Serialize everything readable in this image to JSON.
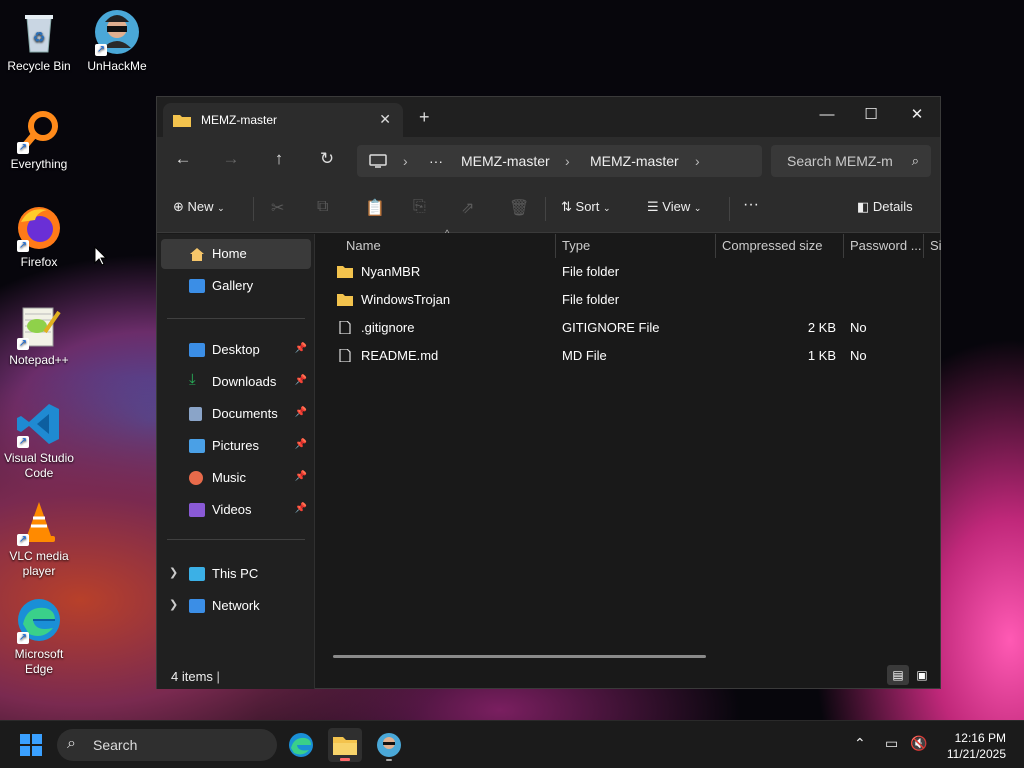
{
  "desktop": {
    "icons": [
      {
        "label": "Recycle Bin",
        "icon": "recycle-bin-icon"
      },
      {
        "label": "UnHackMe",
        "icon": "unhackme-icon"
      },
      {
        "label": "Everything",
        "icon": "everything-icon"
      },
      {
        "label": "Firefox",
        "icon": "firefox-icon"
      },
      {
        "label": "Notepad++",
        "icon": "notepadpp-icon"
      },
      {
        "label": "Visual Studio Code",
        "icon": "vscode-icon"
      },
      {
        "label": "VLC media player",
        "icon": "vlc-icon"
      },
      {
        "label": "Microsoft Edge",
        "icon": "edge-icon"
      }
    ]
  },
  "window": {
    "tab_title": "MEMZ-master",
    "new_tab": "+",
    "controls": {
      "minimize": "—",
      "maximize": "☐",
      "close": "✕"
    }
  },
  "nav": {
    "back": "←",
    "forward": "→",
    "up": "↑",
    "refresh": "↻",
    "breadcrumb": [
      "MEMZ-master",
      "MEMZ-master"
    ],
    "more": "···",
    "search_placeholder": "Search MEMZ-m"
  },
  "toolbar": {
    "new_label": "New",
    "sort_label": "Sort",
    "view_label": "View",
    "more": "···",
    "details_label": "Details"
  },
  "sidebar": {
    "top": [
      {
        "label": "Home",
        "icon": "home-icon",
        "color": "#f6c66a",
        "selected": true
      },
      {
        "label": "Gallery",
        "icon": "gallery-icon",
        "color": "#3b8ee6"
      }
    ],
    "pinned": [
      {
        "label": "Desktop",
        "icon": "desktop-icon",
        "color": "#3b8ee6"
      },
      {
        "label": "Downloads",
        "icon": "downloads-icon",
        "color": "#27b35a"
      },
      {
        "label": "Documents",
        "icon": "documents-icon",
        "color": "#8aa4c8"
      },
      {
        "label": "Pictures",
        "icon": "pictures-icon",
        "color": "#4aa0e6"
      },
      {
        "label": "Music",
        "icon": "music-icon",
        "color": "#e86a4a"
      },
      {
        "label": "Videos",
        "icon": "videos-icon",
        "color": "#8a5ad6"
      }
    ],
    "bottom": [
      {
        "label": "This PC",
        "icon": "this-pc-icon",
        "color": "#3bb0e6"
      },
      {
        "label": "Network",
        "icon": "network-icon",
        "color": "#3b8ee6"
      }
    ]
  },
  "columns": [
    "Name",
    "Type",
    "Compressed size",
    "Password ...",
    "Si"
  ],
  "files": [
    {
      "name": "NyanMBR",
      "type": "File folder",
      "size": "",
      "password": "",
      "kind": "folder"
    },
    {
      "name": "WindowsTrojan",
      "type": "File folder",
      "size": "",
      "password": "",
      "kind": "folder"
    },
    {
      "name": ".gitignore",
      "type": "GITIGNORE File",
      "size": "2 KB",
      "password": "No",
      "kind": "file"
    },
    {
      "name": "README.md",
      "type": "MD File",
      "size": "1 KB",
      "password": "No",
      "kind": "file"
    }
  ],
  "status": {
    "items": "4 items"
  },
  "taskbar": {
    "search_label": "Search",
    "time": "12:16 PM",
    "date": "11/21/2025"
  },
  "colors": {
    "accent": "#f6c66a",
    "folder": "#f3c34d",
    "window_bg": "#191919"
  }
}
